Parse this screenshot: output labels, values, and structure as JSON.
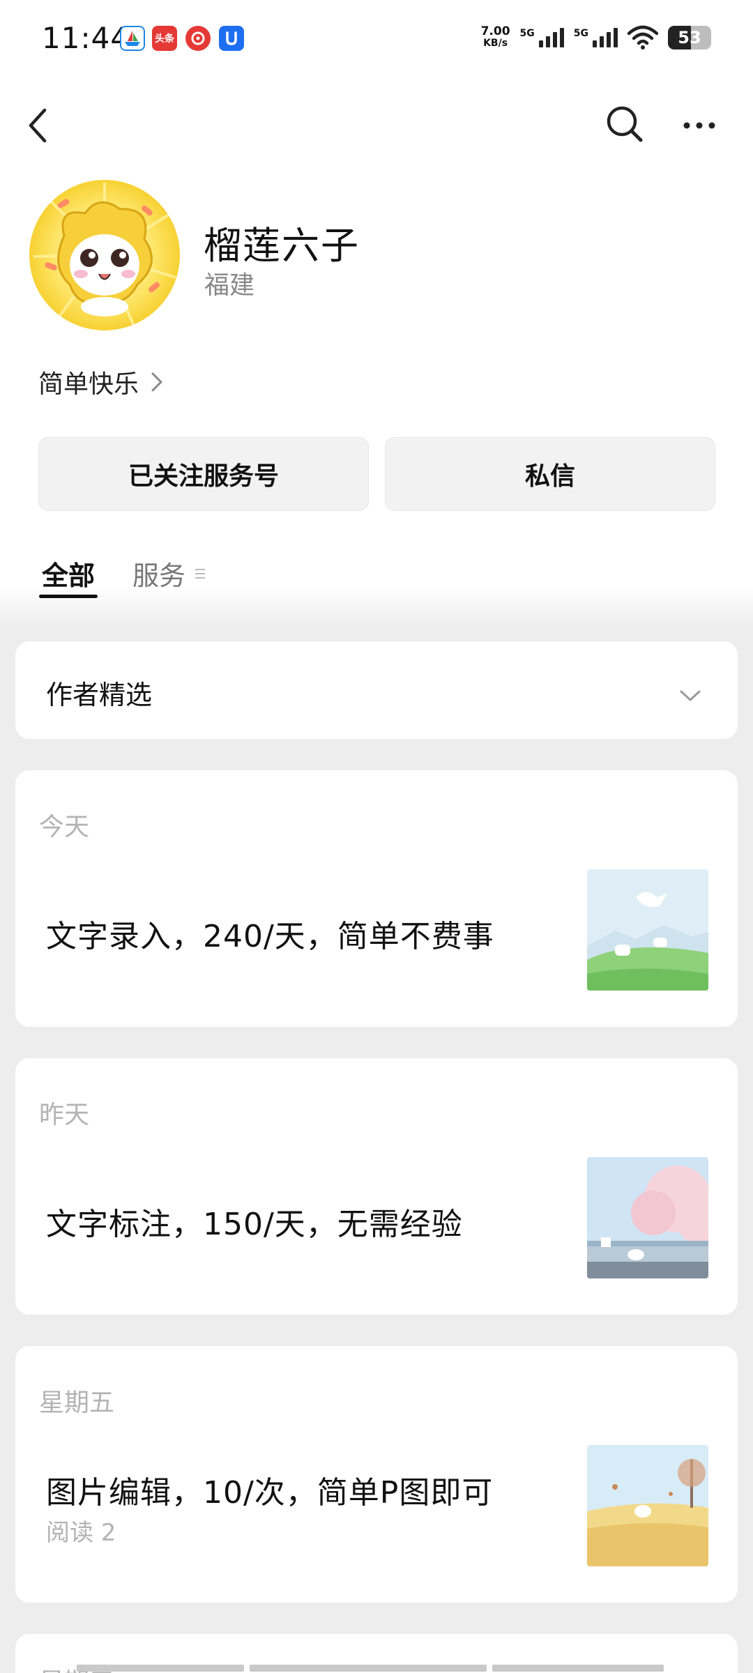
{
  "status_bar": {
    "time": "11:44",
    "app_icons": [
      {
        "name": "boat-app-icon",
        "color": "#1e88e5"
      },
      {
        "name": "toutiao-app-icon",
        "label": "头条",
        "color": "#e53935"
      },
      {
        "name": "music-app-icon",
        "color": "#e53935"
      },
      {
        "name": "u-app-icon",
        "color": "#1e6ff0"
      }
    ],
    "net_speed_value": "7.00",
    "net_speed_unit": "KB/s",
    "sim1_label": "5G",
    "sim2_label": "5G",
    "battery": "53"
  },
  "nav": {
    "back_icon": "chevron-left-icon",
    "search_icon": "search-icon",
    "more_icon": "more-icon"
  },
  "profile": {
    "name": "榴莲六子",
    "region": "福建",
    "signature": "简单快乐",
    "avatar_colors": [
      "#fde568",
      "#f6c52a"
    ]
  },
  "actions": {
    "follow_label": "已关注服务号",
    "message_label": "私信"
  },
  "tabs": [
    {
      "label": "全部",
      "active": true
    },
    {
      "label": "服务",
      "active": false
    }
  ],
  "filter": {
    "label": "作者精选"
  },
  "articles": [
    {
      "date": "今天",
      "title": "文字录入，240/天，简单不费事",
      "meta": ""
    },
    {
      "date": "昨天",
      "title": "文字标注，150/天，无需经验",
      "meta": ""
    },
    {
      "date": "星期五",
      "title": "图片编辑，10/次，简单P图即可",
      "meta": "阅读 2"
    },
    {
      "date": "星期五",
      "title": "",
      "meta": ""
    }
  ]
}
